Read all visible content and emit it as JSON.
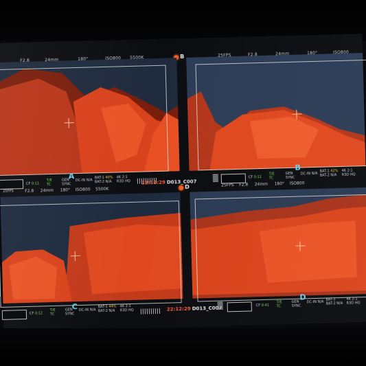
{
  "monitor": {
    "top_bar": {
      "fps_b": "25FPS",
      "fstop_a": "F2.8",
      "fstop_b": "F2.8",
      "focal_a": "24mm",
      "focal_b": "24mm",
      "shutter_a": "180°",
      "shutter_b": "180°",
      "iso_a": "ISO800",
      "iso_b": "ISO800",
      "wb_a": "5500K"
    },
    "center_tags": {
      "top": "B",
      "mid": "D"
    },
    "panels": [
      {
        "letter": "A",
        "cf_label": "CF",
        "cf_value": "0:11",
        "te": "T/E",
        "tc": "TC",
        "fps": "25FPS",
        "fstop": "F2.8",
        "focal": "24mm",
        "shutter": "180°",
        "iso": "ISO800",
        "wb": "5500K",
        "gen": "GEN",
        "sync": "SYNC",
        "dcin": "DC-IN",
        "na": "N/A",
        "bat1": "BAT-1",
        "bat1_pct": "40%",
        "bat2": "BAT-2",
        "bat2_val": "N/A",
        "res": "4K 2:1",
        "codec": "R3D HQ"
      },
      {
        "letter": "B",
        "cf_label": "CF",
        "cf_value": "0:11",
        "te": "T/E",
        "tc": "TC",
        "fps": "25FPS",
        "fstop": "F2.8",
        "focal": "24mm",
        "shutter": "180°",
        "iso": "ISO800",
        "gen": "GEN",
        "sync": "SYNC",
        "dcin": "DC-IN",
        "na": "N/A",
        "bat1": "BAT-1",
        "bat1_pct": "42%",
        "bat2": "BAT-2",
        "bat2_val": "N/A",
        "res": "4K 2:1",
        "codec": "R3D HQ"
      },
      {
        "letter": "C",
        "cf_label": "CF",
        "cf_value": "0:12",
        "te": "T/E",
        "tc": "TC",
        "gen": "GEN",
        "sync": "SYNC",
        "dcin": "DC-IN",
        "na": "N/A",
        "bat1": "BAT-1",
        "bat1_pct": "44%",
        "bat2": "BAT-2",
        "bat2_val": "N/A",
        "res": "4K 2:1",
        "codec": "R3D HQ"
      },
      {
        "letter": "D",
        "cf_label": "CF",
        "cf_value": "0:41",
        "te": "T/E",
        "tc": "TC",
        "gen": "GEN",
        "sync": "SYNC",
        "dcin": "DC-IN",
        "na": "N/A",
        "bat1": "BAT-1",
        "bat1_pct": "",
        "bat2": "BAT-2",
        "bat2_val": "N/A",
        "res": "4K 2:1",
        "codec": "R3D HQ"
      }
    ],
    "timecode_top": {
      "time": "22:12:29",
      "clip": "D013_C007"
    },
    "timecode_bottom": {
      "time": "22:12:29",
      "clip": "D013_C007"
    },
    "colors": {
      "rock": "#d8421c",
      "sky": "#2a3a52",
      "accent": "#6fd0e6",
      "record": "#ff5a1e"
    }
  }
}
